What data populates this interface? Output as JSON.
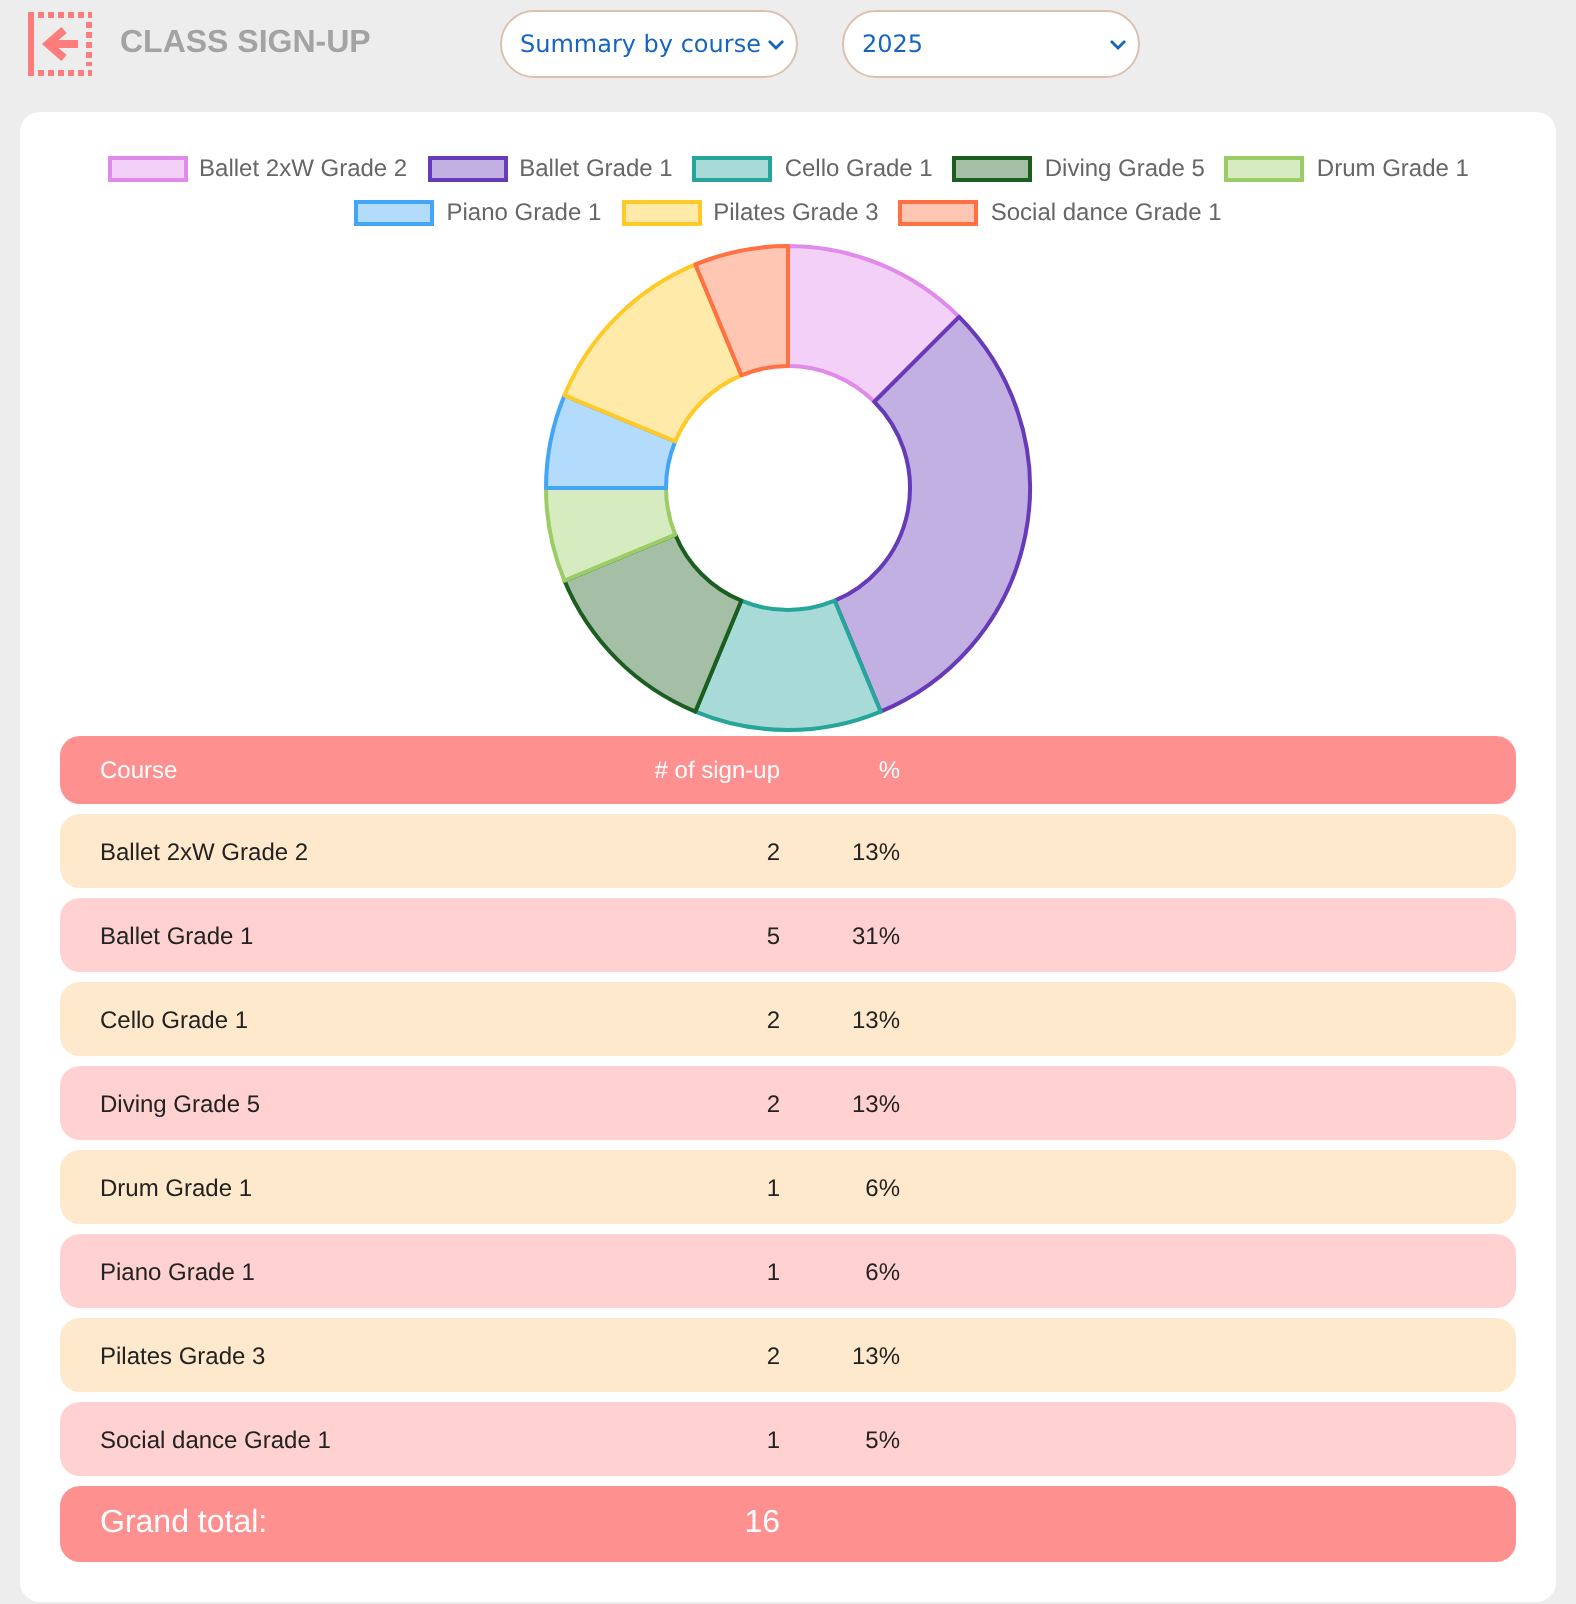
{
  "header": {
    "title": "CLASS SIGN-UP",
    "filters": [
      {
        "value": "Summary by course"
      },
      {
        "value": "2025"
      }
    ]
  },
  "chart": {
    "chart_data": {
      "type": "donut",
      "categories": [
        "Ballet 2xW Grade 2",
        "Ballet Grade 1",
        "Cello Grade 1",
        "Diving Grade 5",
        "Drum Grade 1",
        "Piano Grade 1",
        "Pilates Grade 3",
        "Social dance Grade 1"
      ],
      "values": [
        2,
        5,
        2,
        2,
        1,
        1,
        2,
        1
      ],
      "colors": [
        "#e08aea",
        "#673ab7",
        "#26a69a",
        "#1b5e20",
        "#9ccc65",
        "#42a5f5",
        "#ffca28",
        "#ff7043"
      ],
      "legend": true
    }
  },
  "table": {
    "columns": [
      "Course",
      "# of sign-up",
      "%"
    ],
    "rows": [
      {
        "course": "Ballet 2xW Grade 2",
        "signups": "2",
        "percent": "13%"
      },
      {
        "course": "Ballet Grade 1",
        "signups": "5",
        "percent": "31%"
      },
      {
        "course": "Cello Grade 1",
        "signups": "2",
        "percent": "13%"
      },
      {
        "course": "Diving Grade 5",
        "signups": "2",
        "percent": "13%"
      },
      {
        "course": "Drum Grade 1",
        "signups": "1",
        "percent": "6%"
      },
      {
        "course": "Piano Grade 1",
        "signups": "1",
        "percent": "6%"
      },
      {
        "course": "Pilates Grade 3",
        "signups": "2",
        "percent": "13%"
      },
      {
        "course": "Social dance Grade 1",
        "signups": "1",
        "percent": "5%"
      }
    ],
    "total": {
      "label": "Grand total:",
      "value": "16"
    }
  }
}
